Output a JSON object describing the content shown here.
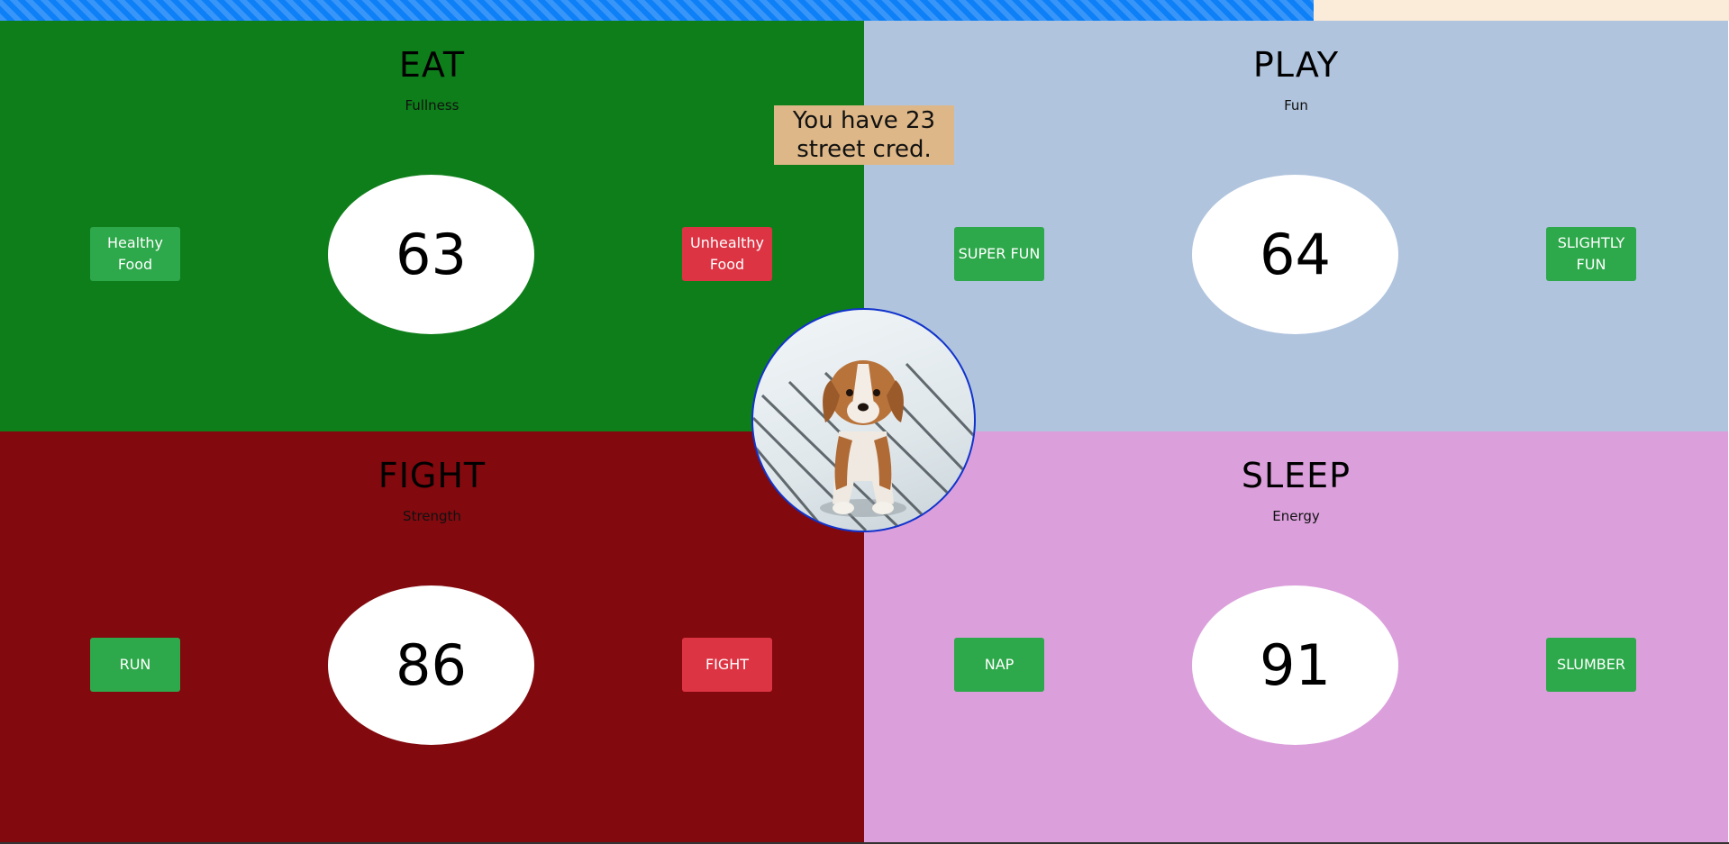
{
  "progress": {
    "value_percent": 76,
    "fill_color": "#0d7ff7",
    "track_color": "#fbebd9"
  },
  "street_cred": {
    "text": "You have 23 street cred."
  },
  "eat": {
    "title": "EAT",
    "subtitle": "Fullness",
    "value": "63",
    "left_button": "Healthy Food",
    "right_button": "Unhealthy Food",
    "bg_color": "#0e7e1a"
  },
  "play": {
    "title": "PLAY",
    "subtitle": "Fun",
    "value": "64",
    "left_button": "SUPER FUN",
    "right_button": "SLIGHTLY FUN",
    "bg_color": "#b0c4de"
  },
  "fight": {
    "title": "FIGHT",
    "subtitle": "Strength",
    "value": "86",
    "left_button": "RUN",
    "right_button": "FIGHT",
    "bg_color": "#82090e"
  },
  "sleep": {
    "title": "SLEEP",
    "subtitle": "Energy",
    "value": "91",
    "left_button": "NAP",
    "right_button": "SLUMBER",
    "bg_color": "#dba0dc"
  },
  "pet": {
    "icon": "puppy-image"
  }
}
